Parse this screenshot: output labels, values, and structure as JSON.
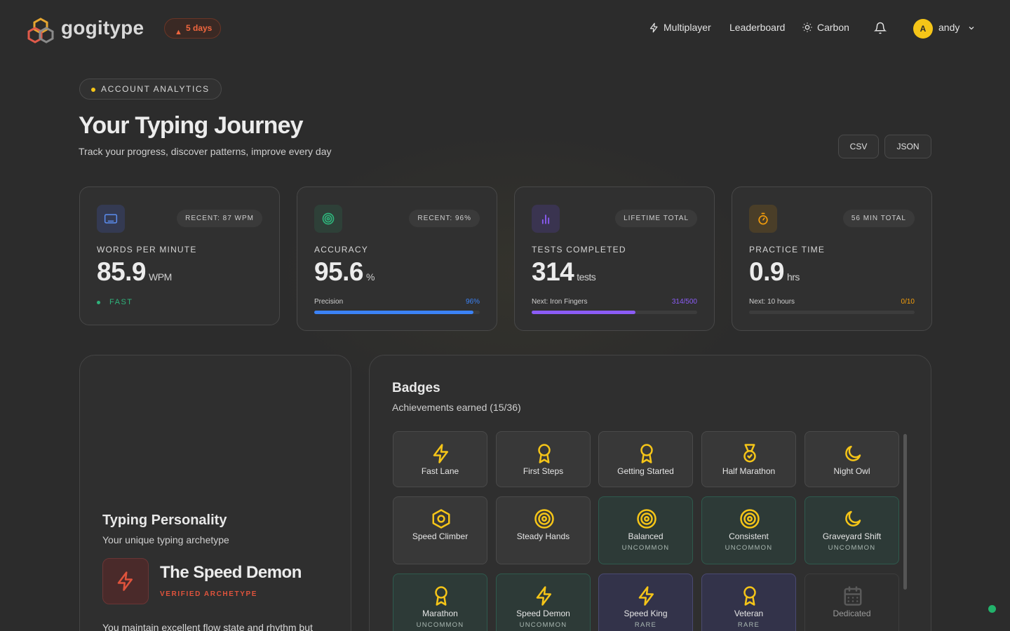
{
  "header": {
    "brand": "gogitype",
    "streak": "5 days",
    "nav": {
      "multiplayer": "Multiplayer",
      "leaderboard": "Leaderboard",
      "theme": "Carbon"
    },
    "user": {
      "initial": "A",
      "name": "andy"
    }
  },
  "hero": {
    "pill": "ACCOUNT ANALYTICS",
    "title": "Your Typing Journey",
    "subtitle": "Track your progress, discover patterns, improve every day",
    "export_csv": "CSV",
    "export_json": "JSON"
  },
  "stats": {
    "wpm": {
      "chip": "RECENT: 87 WPM",
      "label": "WORDS PER MINUTE",
      "value": "85.9",
      "unit": "WPM",
      "tag": "FAST"
    },
    "accuracy": {
      "chip": "RECENT: 96%",
      "label": "ACCURACY",
      "value": "95.6",
      "unit": "%",
      "progress_label": "Precision",
      "progress_value": "96%",
      "progress": 0.96,
      "color": "#3b82f6"
    },
    "tests": {
      "chip": "LIFETIME TOTAL",
      "label": "TESTS COMPLETED",
      "value": "314",
      "unit": "tests",
      "progress_label": "Next: Iron Fingers",
      "progress_value": "314/500",
      "progress": 0.628,
      "color": "#8b5cf6"
    },
    "time": {
      "chip": "56 MIN TOTAL",
      "label": "PRACTICE TIME",
      "value": "0.9",
      "unit": "hrs",
      "progress_label": "Next: 10 hours",
      "progress_value": "0/10",
      "progress": 0.0,
      "color": "#f59e0b"
    }
  },
  "personality": {
    "title": "Typing Personality",
    "subtitle": "Your unique typing archetype",
    "icon": "lightning-icon",
    "name": "The Speed Demon",
    "verified": "VERIFIED ARCHETYPE",
    "description": "You maintain excellent flow state and rhythm but"
  },
  "badges": {
    "title": "Badges",
    "subtitle": "Achievements earned (15/36)",
    "items": [
      {
        "name": "Fast Lane",
        "rarity": "",
        "icon": "lightning-icon",
        "tier": "common"
      },
      {
        "name": "First Steps",
        "rarity": "",
        "icon": "award-icon",
        "tier": "common"
      },
      {
        "name": "Getting Started",
        "rarity": "",
        "icon": "award-icon",
        "tier": "common"
      },
      {
        "name": "Half Marathon",
        "rarity": "",
        "icon": "medal-icon",
        "tier": "common"
      },
      {
        "name": "Night Owl",
        "rarity": "",
        "icon": "moon-icon",
        "tier": "common"
      },
      {
        "name": "Speed Climber",
        "rarity": "",
        "icon": "hexagon-icon",
        "tier": "common"
      },
      {
        "name": "Steady Hands",
        "rarity": "",
        "icon": "target-icon",
        "tier": "common"
      },
      {
        "name": "Balanced",
        "rarity": "UNCOMMON",
        "icon": "target-icon",
        "tier": "uncommon"
      },
      {
        "name": "Consistent",
        "rarity": "UNCOMMON",
        "icon": "target-icon",
        "tier": "uncommon"
      },
      {
        "name": "Graveyard Shift",
        "rarity": "UNCOMMON",
        "icon": "moon-icon",
        "tier": "uncommon"
      },
      {
        "name": "Marathon",
        "rarity": "UNCOMMON",
        "icon": "award-icon",
        "tier": "uncommon"
      },
      {
        "name": "Speed Demon",
        "rarity": "UNCOMMON",
        "icon": "lightning-icon",
        "tier": "uncommon"
      },
      {
        "name": "Speed King",
        "rarity": "RARE",
        "icon": "lightning-icon",
        "tier": "rare"
      },
      {
        "name": "Veteran",
        "rarity": "RARE",
        "icon": "award-icon",
        "tier": "rare"
      },
      {
        "name": "Dedicated",
        "rarity": "",
        "icon": "calendar-icon",
        "tier": "locked"
      }
    ]
  },
  "colors": {
    "accent": "#f5c518",
    "streak": "#f0663e",
    "success": "#2fb37b",
    "archetype": "#e0533c"
  }
}
